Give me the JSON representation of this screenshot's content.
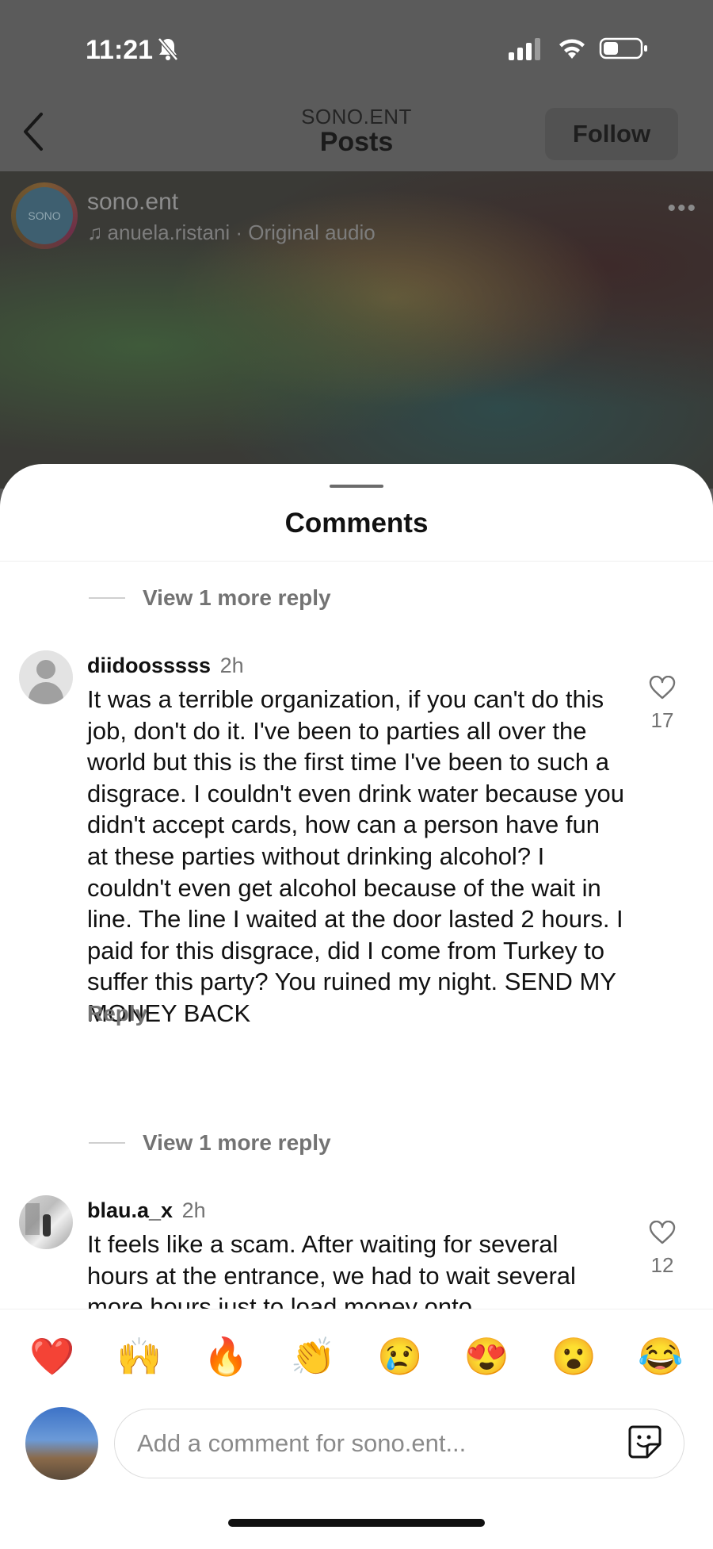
{
  "status": {
    "time": "11:21"
  },
  "nav": {
    "account": "SONO.ENT",
    "title": "Posts",
    "follow": "Follow"
  },
  "post": {
    "avatar_text": "SONO",
    "username": "sono.ent",
    "audio": "anuela.ristani · Original audio"
  },
  "sheet": {
    "title": "Comments",
    "view_more_1": "View 1 more reply",
    "view_more_2": "View 1 more reply",
    "comments": [
      {
        "user": "diidoosssss",
        "time": "2h",
        "text": "It was a terrible organization, if you can't do this job, don't do it. I've been to parties all over the world but this is the first time I've been to such a disgrace. I couldn't even drink water because you didn't accept cards, how can a person have fun at these parties without drinking alcohol? I couldn't even get alcohol because of the wait in line. The line I waited at the door lasted 2 hours. I paid for this disgrace, did I come from Turkey to suffer this party? You ruined my night. SEND MY MONEY BACK",
        "reply": "Reply",
        "likes": "17"
      },
      {
        "user": "blau.a_x",
        "time": "2h",
        "text": "It feels like a scam. After waiting for several hours at the entrance, we had to wait several more hours just to load money onto",
        "likes": "12"
      }
    ]
  },
  "emojis": [
    "❤️",
    "🙌",
    "🔥",
    "👏",
    "😢",
    "😍",
    "😮",
    "😂"
  ],
  "composer": {
    "placeholder": "Add a comment for sono.ent..."
  }
}
